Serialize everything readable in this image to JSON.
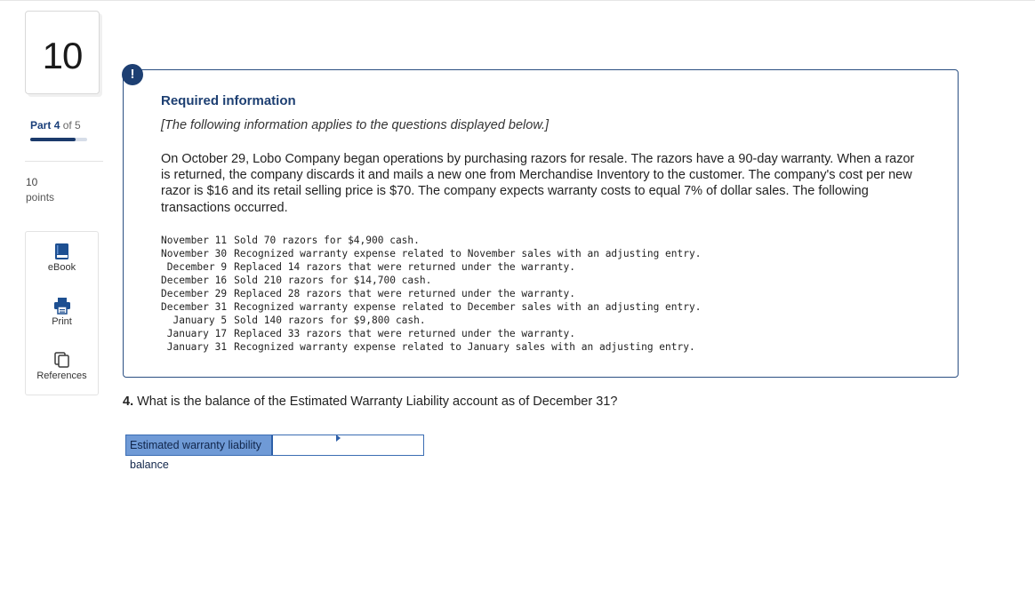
{
  "rail": {
    "question_number": "10",
    "part_prefix": "Part",
    "part_current": "4",
    "part_of": "of 5",
    "progress_fraction": 0.8,
    "points_value": "10",
    "points_label": "points",
    "tools": [
      {
        "label": "eBook",
        "icon": "book-icon"
      },
      {
        "label": "Print",
        "icon": "printer-icon"
      },
      {
        "label": "References",
        "icon": "copy-pages-icon"
      }
    ]
  },
  "alert_glyph": "!",
  "info": {
    "title": "Required information",
    "subtitle": "[The following information applies to the questions displayed below.]",
    "intro": "On October 29, Lobo Company began operations by purchasing razors for resale. The razors have a 90-day warranty. When a razor is returned, the company discards it and mails a new one from Merchandise Inventory to the customer. The company's cost per new razor is $16 and its retail selling price is $70. The company expects warranty costs to equal 7% of dollar sales. The following transactions occurred.",
    "transactions": [
      {
        "date": "November 11",
        "text": "Sold 70 razors for $4,900 cash."
      },
      {
        "date": "November 30",
        "text": "Recognized warranty expense related to November sales with an adjusting entry."
      },
      {
        "date": "December 9",
        "text": "Replaced 14 razors that were returned under the warranty."
      },
      {
        "date": "December 16",
        "text": "Sold 210 razors for $14,700 cash."
      },
      {
        "date": "December 29",
        "text": "Replaced 28 razors that were returned under the warranty."
      },
      {
        "date": "December 31",
        "text": "Recognized warranty expense related to December sales with an adjusting entry."
      },
      {
        "date": "January 5",
        "text": "Sold 140 razors for $9,800 cash."
      },
      {
        "date": "January 17",
        "text": "Replaced 33 razors that were returned under the warranty."
      },
      {
        "date": "January 31",
        "text": "Recognized warranty expense related to January sales with an adjusting entry."
      }
    ]
  },
  "question": {
    "number": "4.",
    "text": "What is the balance of the Estimated Warranty Liability account as of December 31?"
  },
  "answer": {
    "label": "Estimated warranty liability balance",
    "value": ""
  },
  "colors": {
    "accent": "#1d3f72",
    "label_fill": "#6f9ad6",
    "input_border": "#2d5fa8"
  }
}
